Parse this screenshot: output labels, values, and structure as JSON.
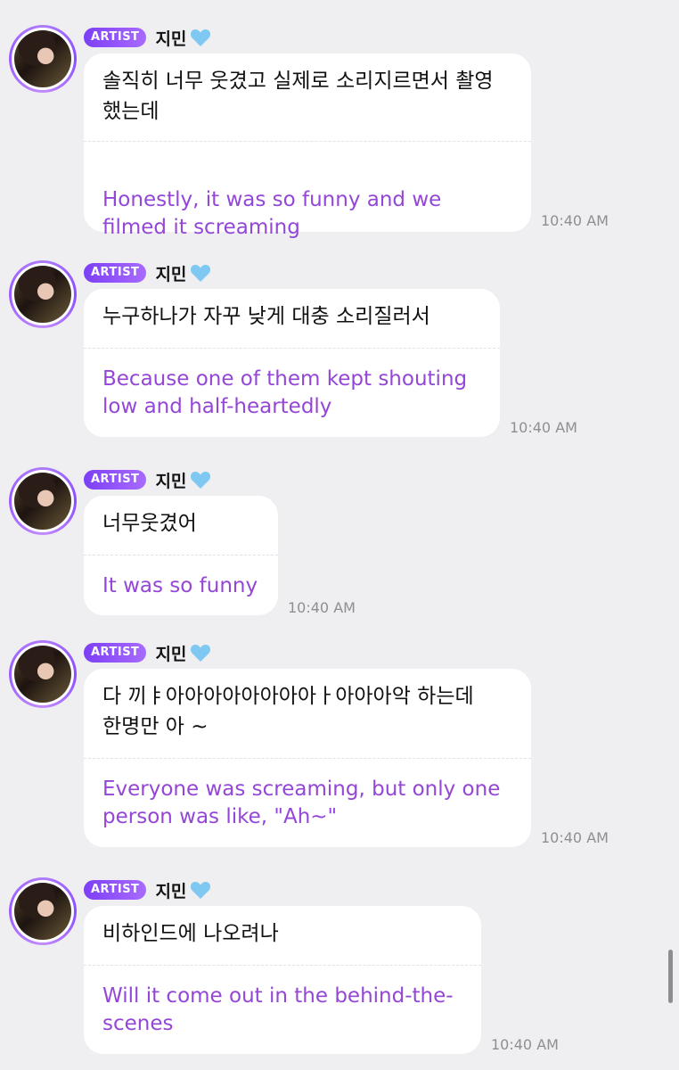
{
  "messages": [
    {
      "badge": "ARTIST",
      "name": "지민",
      "korean": "솔직히 너무 웃겼고 실제로 소리지르면서 촬영\n했는데",
      "english": "Honestly, it was so funny and we\nfilmed it screaming",
      "time": "10:40 AM"
    },
    {
      "badge": "ARTIST",
      "name": "지민",
      "korean": "누구하나가 자꾸 낮게 대충 소리질러서",
      "english": "Because one of them kept shouting\nlow and half-heartedly",
      "time": "10:40 AM"
    },
    {
      "badge": "ARTIST",
      "name": "지민",
      "korean": "너무웃겼어",
      "english": "It was so funny",
      "time": "10:40 AM"
    },
    {
      "badge": "ARTIST",
      "name": "지민",
      "korean": "다 끼ㅑ아아아아아아아아ㅏ아아아악 하는데\n한명만 아 ~",
      "english": "Everyone was screaming, but only one\nperson was like, \"Ah~\"",
      "time": "10:40 AM"
    },
    {
      "badge": "ARTIST",
      "name": "지민",
      "korean": "비하인드에 나오려나",
      "english": "Will it come out in the behind-the-\nscenes",
      "time": "10:40 AM"
    }
  ],
  "colors": {
    "background": "#efeff1",
    "badge": "#8a4dff",
    "translation": "#9446d6",
    "heart": "#7ec8f2"
  },
  "icons": {
    "heart": "light-blue-heart-icon",
    "avatar": "artist-profile-avatar"
  }
}
